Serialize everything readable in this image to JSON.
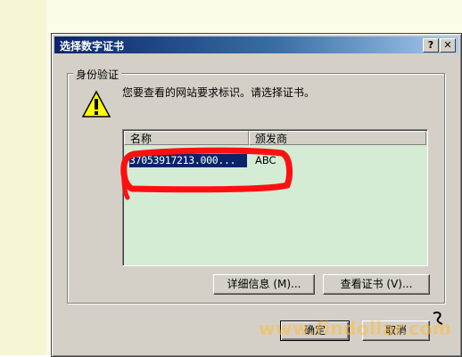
{
  "dialog": {
    "title": "选择数字证书",
    "help_label": "?",
    "close_label": "✕"
  },
  "group": {
    "label": "身份验证",
    "icon": "warning-icon",
    "prompt": "您要查看的网站要求标识。请选择证书。"
  },
  "certificate_list": {
    "columns": [
      "名称",
      "颁发商"
    ],
    "rows": [
      {
        "name": "37053917213.000...",
        "issuer": "ABC",
        "selected": true
      }
    ]
  },
  "buttons": {
    "details": "详细信息 (M)...",
    "view": "查看证书 (V)...",
    "ok": "确定",
    "cancel": "取消"
  },
  "watermark": "www.findollar.com",
  "colors": {
    "title_bar": "#0a246a",
    "dialog_face": "#d4d0c8",
    "list_background": "#d4ecd4",
    "annotation": "#ff0000"
  }
}
